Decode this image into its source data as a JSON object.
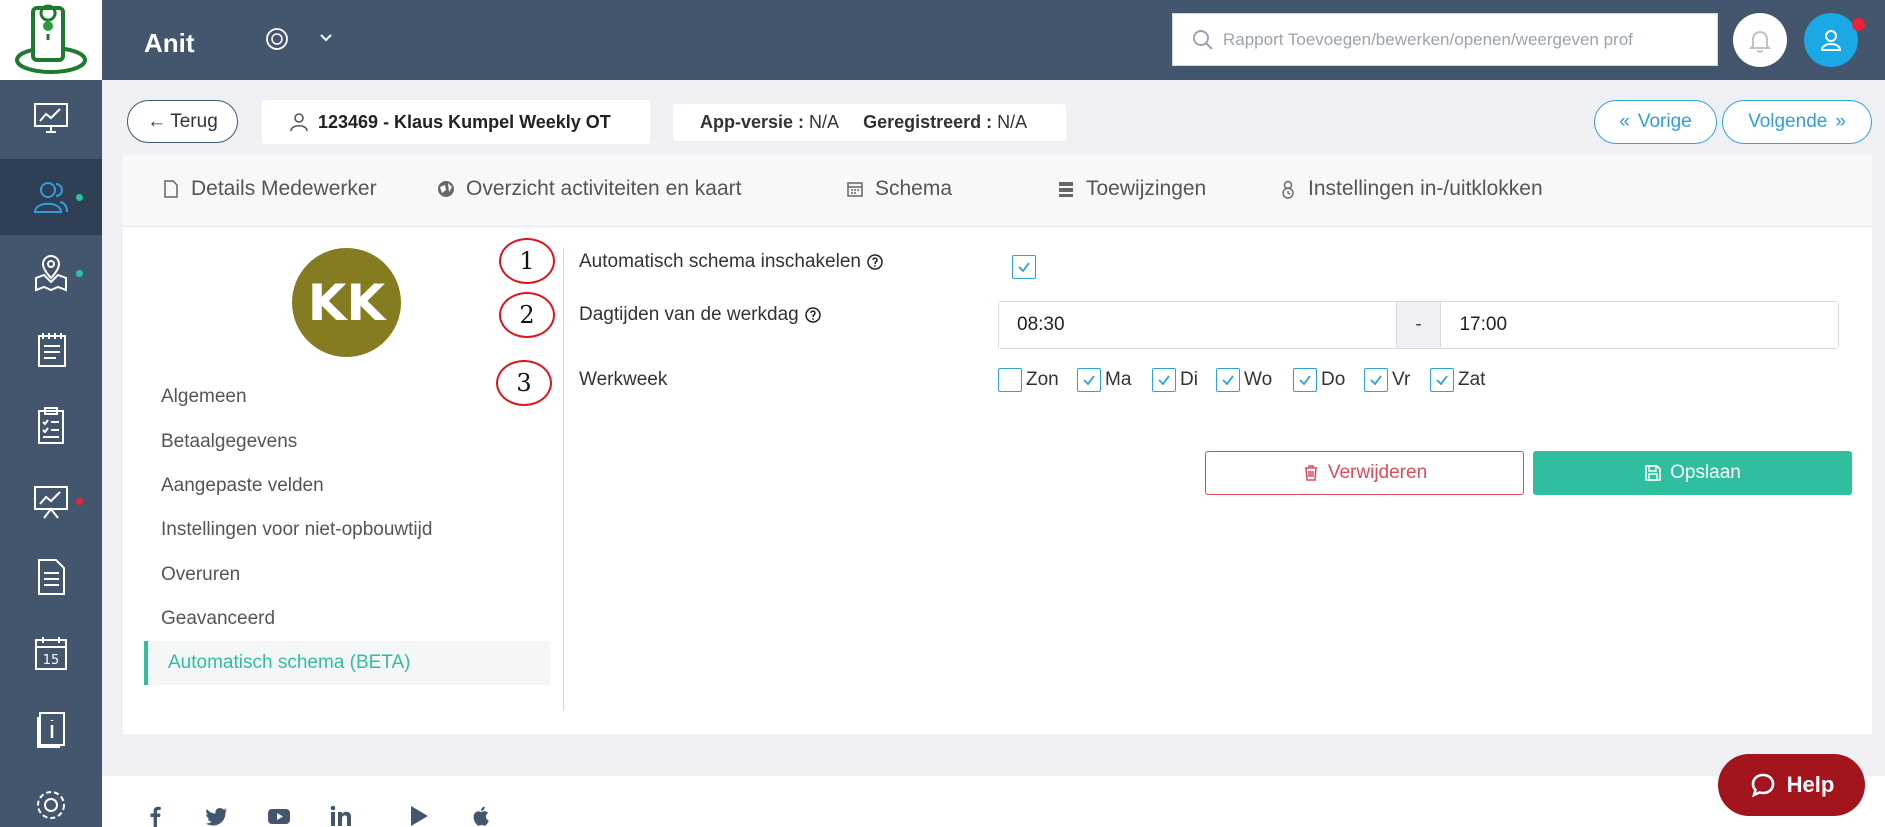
{
  "app": {
    "title": "Anit"
  },
  "search": {
    "placeholder": "Rapport Toevoegen/bewerken/openen/weergeven prof"
  },
  "header": {
    "back_label": "Terug",
    "employee": "123469 - Klaus Kumpel Weekly OT",
    "app_version_label": "App-versie :",
    "app_version_value": "N/A",
    "registered_label": "Geregistreerd :",
    "registered_value": "N/A",
    "prev_label": "Vorige",
    "next_label": "Volgende"
  },
  "tabs": [
    {
      "label": "Details Medewerker",
      "icon": "document-icon"
    },
    {
      "label": "Overzicht activiteiten en kaart",
      "icon": "globe-icon"
    },
    {
      "label": "Schema",
      "icon": "calendar-icon"
    },
    {
      "label": "Toewijzingen",
      "icon": "list-icon"
    },
    {
      "label": "Instellingen in-/uitklokken",
      "icon": "clock-user-icon"
    }
  ],
  "profile": {
    "initials": "KK"
  },
  "menu": [
    "Algemeen",
    "Betaalgegevens",
    "Aangepaste velden",
    "Instellingen voor niet-opbouwtijd",
    "Overuren",
    "Geavanceerd",
    "Automatisch schema (BETA)"
  ],
  "annotations": [
    "1",
    "2",
    "3"
  ],
  "form": {
    "auto_schedule_label": "Automatisch schema inschakelen",
    "auto_schedule_checked": true,
    "day_times_label": "Dagtijden van de werkdag",
    "start_time": "08:30",
    "separator": "-",
    "end_time": "17:00",
    "workweek_label": "Werkweek",
    "days": [
      {
        "label": "Zon",
        "checked": false
      },
      {
        "label": "Ma",
        "checked": true
      },
      {
        "label": "Di",
        "checked": true
      },
      {
        "label": "Wo",
        "checked": true
      },
      {
        "label": "Do",
        "checked": true
      },
      {
        "label": "Vr",
        "checked": true
      },
      {
        "label": "Zat",
        "checked": true
      }
    ],
    "delete_label": "Verwijderen",
    "save_label": "Opslaan"
  },
  "help": {
    "label": "Help"
  },
  "colors": {
    "sidebar": "#44566e",
    "accent": "#2fa0d9",
    "success": "#2fbf9f",
    "danger": "#e04b5a",
    "avatar": "#857b20",
    "help": "#a3141c"
  }
}
